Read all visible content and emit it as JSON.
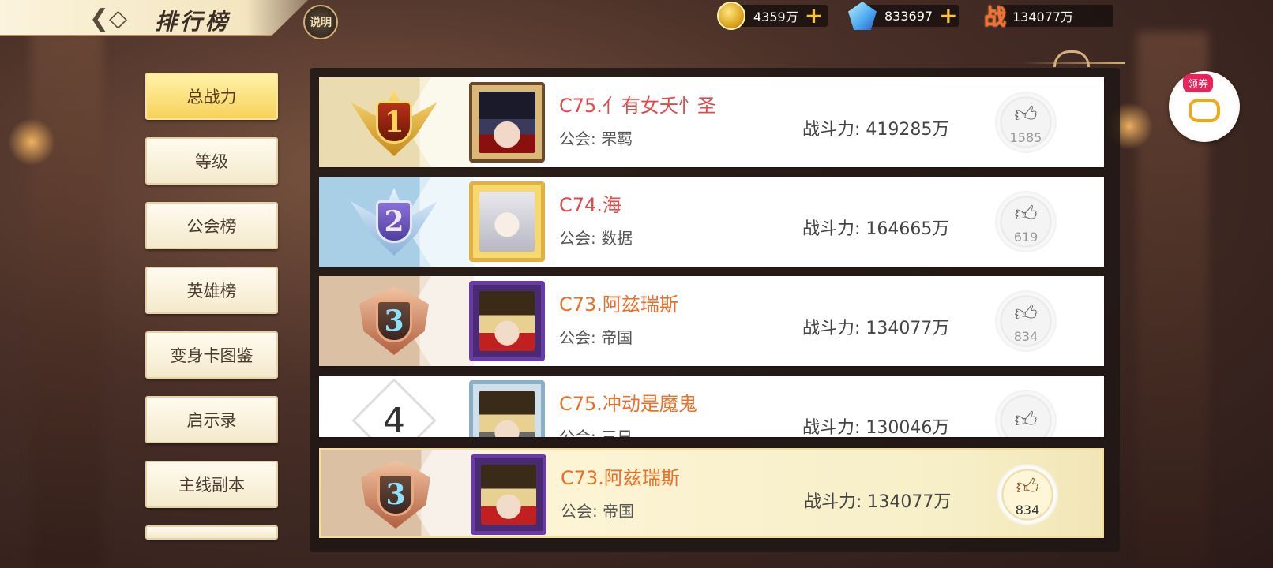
{
  "header": {
    "back_icon": "back-arrow-icon",
    "title": "排行榜",
    "help_label": "说明"
  },
  "resources": [
    {
      "icon": "gold-coin-icon",
      "value": "4359万",
      "has_plus": true
    },
    {
      "icon": "diamond-icon",
      "value": "833697",
      "has_plus": true
    },
    {
      "icon": "battle-power-icon",
      "label": "战",
      "value": "134077万",
      "has_plus": false
    }
  ],
  "menu": {
    "items": [
      {
        "label": "总战力",
        "active": true
      },
      {
        "label": "等级",
        "active": false
      },
      {
        "label": "公会榜",
        "active": false
      },
      {
        "label": "英雄榜",
        "active": false
      },
      {
        "label": "变身卡图鉴",
        "active": false
      },
      {
        "label": "启示录",
        "active": false
      },
      {
        "label": "主线副本",
        "active": false
      }
    ]
  },
  "rankings": [
    {
      "rank": "1",
      "name": "C75.亻有女夭忄圣",
      "guild_prefix": "公会: ",
      "guild": "罘羁",
      "power_label": "战斗力: ",
      "power": "419285万",
      "likes": "1585"
    },
    {
      "rank": "2",
      "name": "C74.海",
      "guild_prefix": "公会: ",
      "guild": "数据",
      "power_label": "战斗力: ",
      "power": "164665万",
      "likes": "619"
    },
    {
      "rank": "3",
      "name": "C73.阿兹瑞斯",
      "guild_prefix": "公会: ",
      "guild": "帝国",
      "power_label": "战斗力: ",
      "power": "134077万",
      "likes": "834"
    },
    {
      "rank": "4",
      "name": "C75.冲动是魔鬼",
      "guild_prefix": "公会: ",
      "guild": "三日",
      "power_label": "战斗力: ",
      "power": "130046万",
      "likes": ""
    }
  ],
  "self_row": {
    "rank": "3",
    "name": "C73.阿兹瑞斯",
    "guild_prefix": "公会: ",
    "guild": "帝国",
    "power_label": "战斗力: ",
    "power": "134077万",
    "likes": "834"
  },
  "float": {
    "coupon_label": "领券",
    "icon": "gamepad-icon"
  },
  "colors": {
    "name_red": "#e24a4a",
    "name_orange": "#e8702a",
    "menu_active": "#f7d25a"
  }
}
